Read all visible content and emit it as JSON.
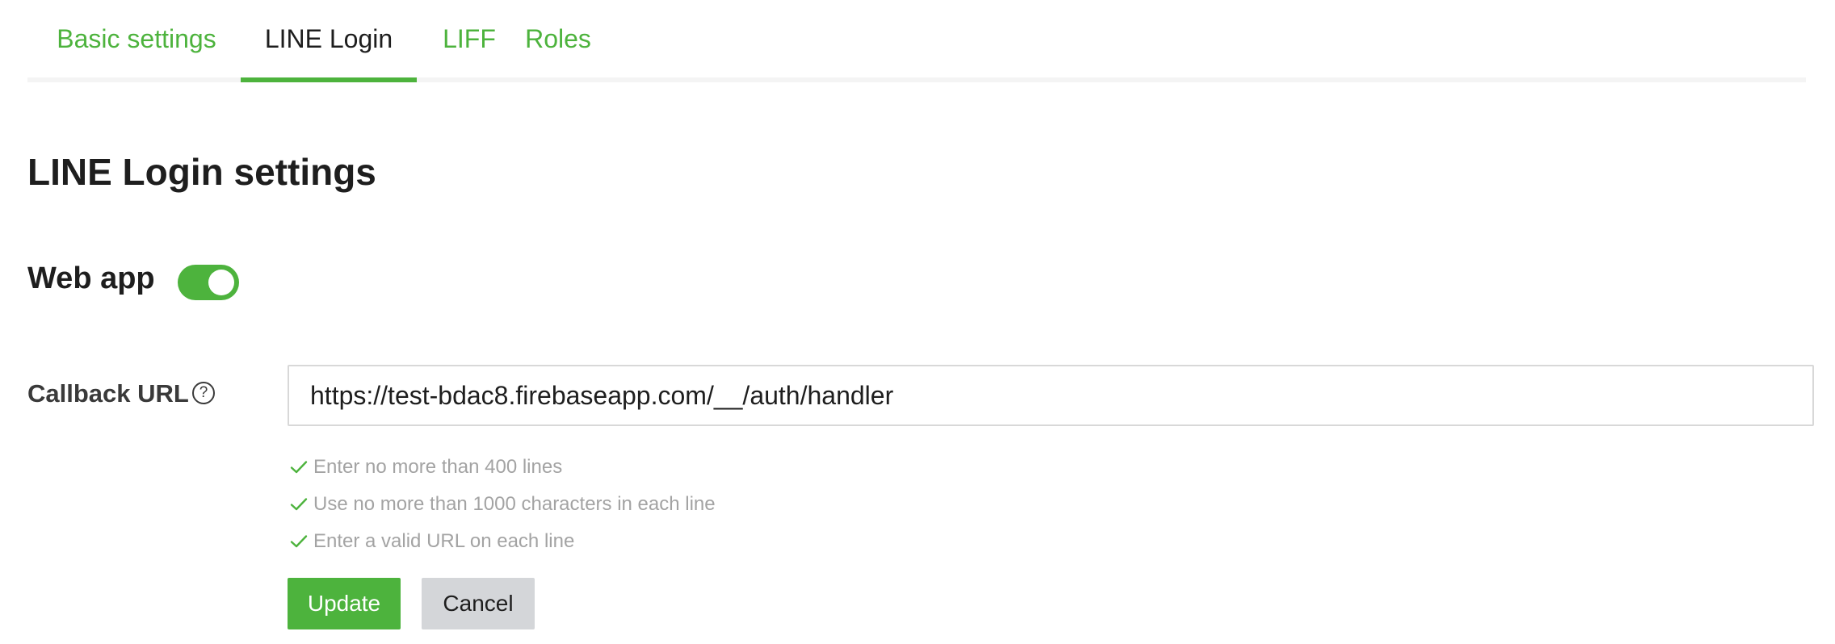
{
  "tabs": [
    {
      "label": "Basic settings",
      "active": false
    },
    {
      "label": "LINE Login",
      "active": true
    },
    {
      "label": "LIFF",
      "active": false
    },
    {
      "label": "Roles",
      "active": false
    }
  ],
  "page_title": "LINE Login settings",
  "web_app": {
    "label": "Web app",
    "enabled": true
  },
  "callback": {
    "label": "Callback URL",
    "help_icon": "question-circle-icon",
    "help_glyph": "?",
    "value": "https://test-bdac8.firebaseapp.com/__/auth/handler"
  },
  "rules": [
    {
      "text": "Enter no more than 400 lines",
      "icon": "check-icon"
    },
    {
      "text": "Use no more than 1000 characters in each line",
      "icon": "check-icon"
    },
    {
      "text": "Enter a valid URL on each line",
      "icon": "check-icon"
    }
  ],
  "buttons": {
    "update_label": "Update",
    "cancel_label": "Cancel"
  },
  "colors": {
    "accent": "#4db33d",
    "text": "#1e1e1e",
    "muted": "#a3a3a3",
    "cancel_bg": "#d4d6d9"
  }
}
